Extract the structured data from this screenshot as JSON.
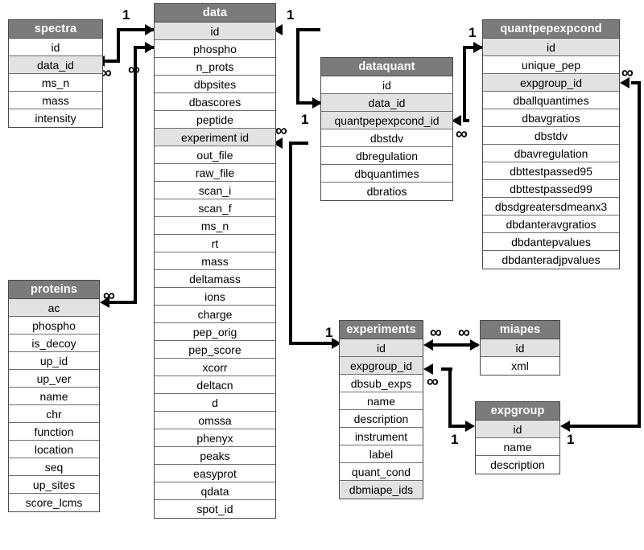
{
  "diagram": {
    "title": "Database schema entity-relationship diagram",
    "colors": {
      "header_bg": "#7b7b7b",
      "header_text": "#ffffff",
      "key_row_bg": "#e2e2e2",
      "row_bg": "#ffffff",
      "border": "#4a4a4a",
      "connector": "#000000"
    }
  },
  "entities": {
    "spectra": {
      "name": "spectra",
      "fields": [
        {
          "label": "id",
          "key": false
        },
        {
          "label": "data_id",
          "key": true
        },
        {
          "label": "ms_n",
          "key": false
        },
        {
          "label": "mass",
          "key": false
        },
        {
          "label": "intensity",
          "key": false
        }
      ]
    },
    "data": {
      "name": "data",
      "fields": [
        {
          "label": "id",
          "key": true
        },
        {
          "label": "phospho",
          "key": false
        },
        {
          "label": "n_prots",
          "key": false
        },
        {
          "label": "dbpsites",
          "key": false
        },
        {
          "label": "dbascores",
          "key": false
        },
        {
          "label": "peptide",
          "key": false
        },
        {
          "label": "experiment id",
          "key": true
        },
        {
          "label": "out_file",
          "key": false
        },
        {
          "label": "raw_file",
          "key": false
        },
        {
          "label": "scan_i",
          "key": false
        },
        {
          "label": "scan_f",
          "key": false
        },
        {
          "label": "ms_n",
          "key": false
        },
        {
          "label": "rt",
          "key": false
        },
        {
          "label": "mass",
          "key": false
        },
        {
          "label": "deltamass",
          "key": false
        },
        {
          "label": "ions",
          "key": false
        },
        {
          "label": "charge",
          "key": false
        },
        {
          "label": "pep_orig",
          "key": false
        },
        {
          "label": "pep_score",
          "key": false
        },
        {
          "label": "xcorr",
          "key": false
        },
        {
          "label": "deltacn",
          "key": false
        },
        {
          "label": "d",
          "key": false
        },
        {
          "label": "omssa",
          "key": false
        },
        {
          "label": "phenyx",
          "key": false
        },
        {
          "label": "peaks",
          "key": false
        },
        {
          "label": "easyprot",
          "key": false
        },
        {
          "label": "qdata",
          "key": false
        },
        {
          "label": "spot_id",
          "key": false
        }
      ]
    },
    "dataquant": {
      "name": "dataquant",
      "fields": [
        {
          "label": "id",
          "key": false
        },
        {
          "label": "data_id",
          "key": true
        },
        {
          "label": "quantpepexpcond_id",
          "key": true
        },
        {
          "label": "dbstdv",
          "key": false
        },
        {
          "label": "dbregulation",
          "key": false
        },
        {
          "label": "dbquantimes",
          "key": false
        },
        {
          "label": "dbratios",
          "key": false
        }
      ]
    },
    "quantpepexpcond": {
      "name": "quantpepexpcond",
      "fields": [
        {
          "label": "id",
          "key": true
        },
        {
          "label": "unique_pep",
          "key": false
        },
        {
          "label": "expgroup_id",
          "key": true
        },
        {
          "label": "dballquantimes",
          "key": false
        },
        {
          "label": "dbavgratios",
          "key": false
        },
        {
          "label": "dbstdv",
          "key": false
        },
        {
          "label": "dbavregulation",
          "key": false
        },
        {
          "label": "dbttestpassed95",
          "key": false
        },
        {
          "label": "dbttestpassed99",
          "key": false
        },
        {
          "label": "dbsdgreatersdmeanx3",
          "key": false
        },
        {
          "label": "dbdanteravgratios",
          "key": false
        },
        {
          "label": "dbdantepvalues",
          "key": false
        },
        {
          "label": "dbdanteradjpvalues",
          "key": false
        }
      ]
    },
    "proteins": {
      "name": "proteins",
      "fields": [
        {
          "label": "ac",
          "key": true
        },
        {
          "label": "phospho",
          "key": false
        },
        {
          "label": "is_decoy",
          "key": false
        },
        {
          "label": "up_id",
          "key": false
        },
        {
          "label": "up_ver",
          "key": false
        },
        {
          "label": "name",
          "key": false
        },
        {
          "label": "chr",
          "key": false
        },
        {
          "label": "function",
          "key": false
        },
        {
          "label": "location",
          "key": false
        },
        {
          "label": "seq",
          "key": false
        },
        {
          "label": "up_sites",
          "key": false
        },
        {
          "label": "score_lcms",
          "key": false
        }
      ]
    },
    "experiments": {
      "name": "experiments",
      "fields": [
        {
          "label": "id",
          "key": true
        },
        {
          "label": "expgroup_id",
          "key": true
        },
        {
          "label": "dbsub_exps",
          "key": false
        },
        {
          "label": "name",
          "key": false
        },
        {
          "label": "description",
          "key": false
        },
        {
          "label": "instrument",
          "key": false
        },
        {
          "label": "label",
          "key": false
        },
        {
          "label": "quant_cond",
          "key": false
        },
        {
          "label": "dbmiape_ids",
          "key": true
        }
      ]
    },
    "miapes": {
      "name": "miapes",
      "fields": [
        {
          "label": "id",
          "key": true
        },
        {
          "label": "xml",
          "key": false
        }
      ]
    },
    "expgroup": {
      "name": "expgroup",
      "fields": [
        {
          "label": "id",
          "key": true
        },
        {
          "label": "name",
          "key": false
        },
        {
          "label": "description",
          "key": false
        }
      ]
    }
  },
  "cardinalities": {
    "one": "1",
    "many": "∞",
    "labels": [
      {
        "id": "c1",
        "text": "1",
        "note": "data.id side of spectra.data_id relation"
      },
      {
        "id": "c2",
        "text": "∞",
        "note": "spectra.data_id many side"
      },
      {
        "id": "c3",
        "text": "∞",
        "note": "proteins.ac many side at data.id"
      },
      {
        "id": "c4",
        "text": "∞",
        "note": "proteins.ac many side"
      },
      {
        "id": "c5",
        "text": "1",
        "note": "data.id to dataquant.data_id one side"
      },
      {
        "id": "c6",
        "text": "1",
        "note": "dataquant.data_id one side"
      },
      {
        "id": "c7",
        "text": "1",
        "note": "quantpepexpcond.id one side"
      },
      {
        "id": "c8",
        "text": "∞",
        "note": "dataquant.quantpepexpcond_id many side"
      },
      {
        "id": "c9",
        "text": "∞",
        "note": "quantpepexpcond.expgroup_id many side"
      },
      {
        "id": "c10",
        "text": "1",
        "note": "expgroup.id one side from quantpepexpcond"
      },
      {
        "id": "c11",
        "text": "∞",
        "note": "data.experiment id many side"
      },
      {
        "id": "c12",
        "text": "1",
        "note": "experiments.id one side"
      },
      {
        "id": "c13",
        "text": "∞",
        "note": "experiments.id many side to miapes"
      },
      {
        "id": "c14",
        "text": "∞",
        "note": "miapes.id many side"
      },
      {
        "id": "c15",
        "text": "∞",
        "note": "experiments.expgroup_id many side"
      },
      {
        "id": "c16",
        "text": "1",
        "note": "expgroup.id one side from experiments"
      }
    ]
  },
  "relationships": [
    {
      "from": "data.id",
      "to": "spectra.data_id",
      "from_card": "1",
      "to_card": "∞"
    },
    {
      "from": "data.id",
      "to": "proteins.ac",
      "from_card": "∞",
      "to_card": "∞"
    },
    {
      "from": "data.id",
      "to": "dataquant.data_id",
      "from_card": "1",
      "to_card": "1"
    },
    {
      "from": "quantpepexpcond.id",
      "to": "dataquant.quantpepexpcond_id",
      "from_card": "1",
      "to_card": "∞"
    },
    {
      "from": "quantpepexpcond.expgroup_id",
      "to": "expgroup.id",
      "from_card": "∞",
      "to_card": "1"
    },
    {
      "from": "experiments.id",
      "to": "data.experiment id",
      "from_card": "1",
      "to_card": "∞"
    },
    {
      "from": "experiments.id",
      "to": "miapes.id",
      "from_card": "∞",
      "to_card": "∞"
    },
    {
      "from": "experiments.expgroup_id",
      "to": "expgroup.id",
      "from_card": "∞",
      "to_card": "1"
    }
  ]
}
